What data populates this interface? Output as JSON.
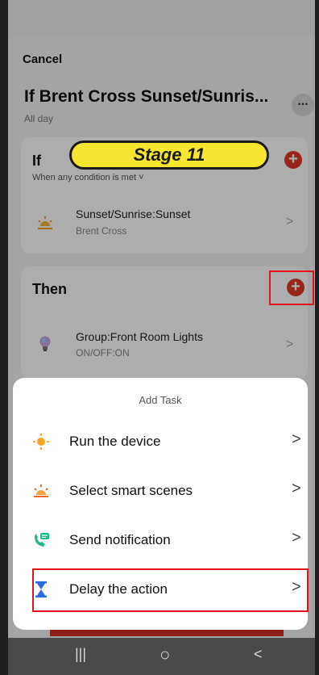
{
  "header": {
    "cancel_label": "Cancel",
    "title": "If Brent Cross Sunset/Sunris...",
    "subtitle": "All day",
    "more_label": "..."
  },
  "if_card": {
    "title": "If",
    "condition_mode": "When any condition is met ˅",
    "add_label": "+",
    "item": {
      "icon": "sunset-icon",
      "main": "Sunset/Sunrise:Sunset",
      "sub": "Brent Cross",
      "chevron": ">"
    }
  },
  "banner": {
    "text": "Stage 11"
  },
  "then_card": {
    "title": "Then",
    "add_label": "+",
    "item": {
      "icon": "lightbulb-icon",
      "main": "Group:Front Room Lights",
      "sub": "ON/OFF:ON",
      "chevron": ">"
    }
  },
  "sheet": {
    "title": "Add Task",
    "tasks": [
      {
        "label": "Run the device",
        "icon": "sun-device-icon",
        "chevron": ">"
      },
      {
        "label": "Select smart scenes",
        "icon": "scene-sunrise-icon",
        "chevron": ">"
      },
      {
        "label": "Send notification",
        "icon": "phone-message-icon",
        "chevron": ">"
      },
      {
        "label": "Delay the action",
        "icon": "hourglass-icon",
        "chevron": ">"
      }
    ]
  },
  "nav": {
    "recents": "|||",
    "home": "○",
    "back": "<"
  },
  "colors": {
    "accent_red": "#e2392c",
    "highlight_red": "#e2141b",
    "banner_yellow": "#f7e52f"
  }
}
